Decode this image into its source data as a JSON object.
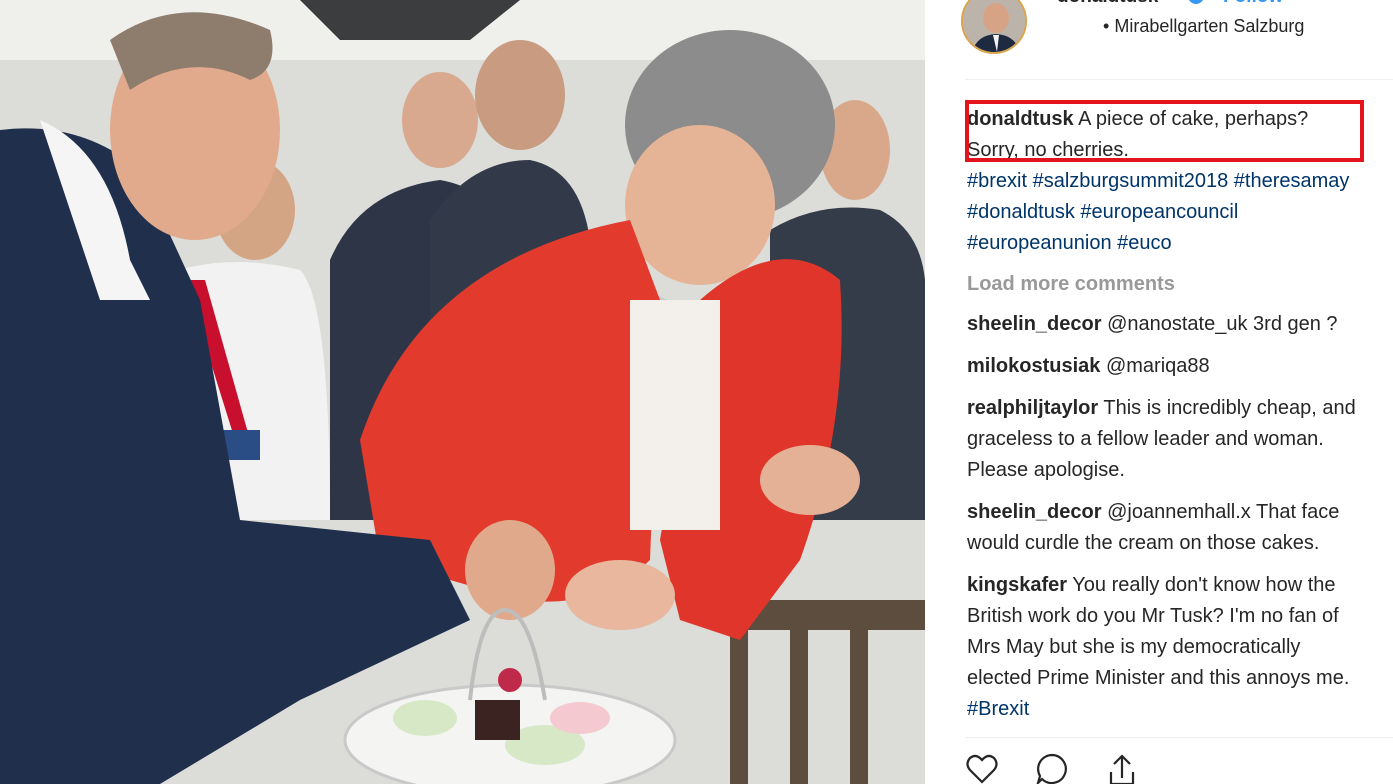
{
  "post": {
    "username": "donaldtusk",
    "follow_label": "Follow",
    "location_bullet": "•",
    "location": "Mirabellgarten Salzburg"
  },
  "caption": {
    "username": "donaldtusk",
    "line1": "A piece of cake, perhaps?",
    "line2": "Sorry, no cherries.",
    "hashtags_line1": "#brexit #salzburgsummit2018 #theresamay",
    "hashtags_line2": "#donaldtusk #europeancouncil",
    "hashtags_line3": "#europeanunion #euco"
  },
  "load_more_label": "Load more comments",
  "comments": [
    {
      "user": "sheelin_decor",
      "lines": [
        "@nanostate_uk 3rd gen ?"
      ]
    },
    {
      "user": "milokostusiak",
      "lines": [
        "@mariqa88"
      ]
    },
    {
      "user": "realphiljtaylor",
      "lines": [
        "This is incredibly cheap, and",
        "graceless to a fellow leader and woman.",
        "Please apologise."
      ]
    },
    {
      "user": "sheelin_decor",
      "lines": [
        "@joannemhall.x That face",
        "would curdle the cream on those cakes."
      ]
    },
    {
      "user": "kingskafer",
      "lines": [
        "You really don't know how the",
        "British work do you Mr Tusk? I'm no fan of",
        "Mrs May but she is my democratically",
        "elected Prime Minister and this annoys me.",
        "#Brexit"
      ]
    }
  ],
  "icons": {
    "like": "heart-icon",
    "comment": "comment-icon",
    "share": "share-icon",
    "verified": "verified-badge-icon"
  },
  "colors": {
    "accent_blue": "#3897f0",
    "highlight_red": "#e3141b",
    "muted_gray": "#999999",
    "hashtag": "#003569"
  }
}
